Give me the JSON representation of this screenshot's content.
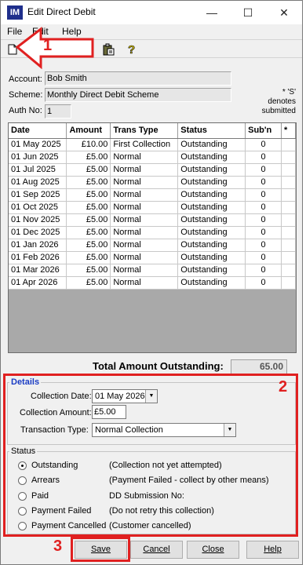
{
  "window": {
    "app_icon_text": "IM",
    "title": "Edit Direct Debit",
    "minimize": "—",
    "maximize": "☐",
    "close": "✕"
  },
  "menu": {
    "file": "File",
    "edit": "Edit",
    "help": "Help"
  },
  "toolbar": {
    "icons": [
      "new-document-icon",
      "clipboard-icon",
      "help-icon"
    ]
  },
  "account": {
    "account_label": "Account:",
    "account_value": "Bob Smith",
    "scheme_label": "Scheme:",
    "scheme_value": "Monthly Direct Debit Scheme",
    "auth_label": "Auth No:",
    "auth_value": "1",
    "note": "* 'S'\ndenotes\nsubmitted"
  },
  "table": {
    "headers": [
      "Date",
      "Amount",
      "Trans Type",
      "Status",
      "Sub'n",
      "*"
    ],
    "rows": [
      [
        "01 May 2025",
        "£10.00",
        "First Collection",
        "Outstanding",
        "0",
        ""
      ],
      [
        "01 Jun 2025",
        "£5.00",
        "Normal",
        "Outstanding",
        "0",
        ""
      ],
      [
        "01 Jul 2025",
        "£5.00",
        "Normal",
        "Outstanding",
        "0",
        ""
      ],
      [
        "01 Aug 2025",
        "£5.00",
        "Normal",
        "Outstanding",
        "0",
        ""
      ],
      [
        "01 Sep 2025",
        "£5.00",
        "Normal",
        "Outstanding",
        "0",
        ""
      ],
      [
        "01 Oct 2025",
        "£5.00",
        "Normal",
        "Outstanding",
        "0",
        ""
      ],
      [
        "01 Nov 2025",
        "£5.00",
        "Normal",
        "Outstanding",
        "0",
        ""
      ],
      [
        "01 Dec 2025",
        "£5.00",
        "Normal",
        "Outstanding",
        "0",
        ""
      ],
      [
        "01 Jan 2026",
        "£5.00",
        "Normal",
        "Outstanding",
        "0",
        ""
      ],
      [
        "01 Feb 2026",
        "£5.00",
        "Normal",
        "Outstanding",
        "0",
        ""
      ],
      [
        "01 Mar 2026",
        "£5.00",
        "Normal",
        "Outstanding",
        "0",
        ""
      ],
      [
        "01 Apr 2026",
        "£5.00",
        "Normal",
        "Outstanding",
        "0",
        ""
      ]
    ]
  },
  "total": {
    "label": "Total Amount Outstanding:",
    "value": "65.00"
  },
  "details": {
    "title": "Details",
    "collection_date_label": "Collection Date:",
    "collection_date_value": "01 May 2026",
    "collection_amount_label": "Collection Amount:",
    "collection_amount_value": "£5.00",
    "transaction_type_label": "Transaction Type:",
    "transaction_type_value": "Normal Collection"
  },
  "status": {
    "title": "Status",
    "options": [
      {
        "label": "Outstanding",
        "desc": "(Collection not yet attempted)",
        "selected": true
      },
      {
        "label": "Arrears",
        "desc": "(Payment Failed - collect by other means)",
        "selected": false
      },
      {
        "label": "Paid",
        "desc": "DD Submission No:",
        "selected": false
      },
      {
        "label": "Payment Failed",
        "desc": "(Do not retry this collection)",
        "selected": false
      },
      {
        "label": "Payment Cancelled",
        "desc": "(Customer cancelled)",
        "selected": false
      }
    ]
  },
  "buttons": {
    "save": "Save",
    "cancel": "Cancel",
    "close": "Close",
    "help": "Help"
  },
  "annotations": {
    "one": "1",
    "two": "2",
    "three": "3",
    "color": "#e02020"
  }
}
